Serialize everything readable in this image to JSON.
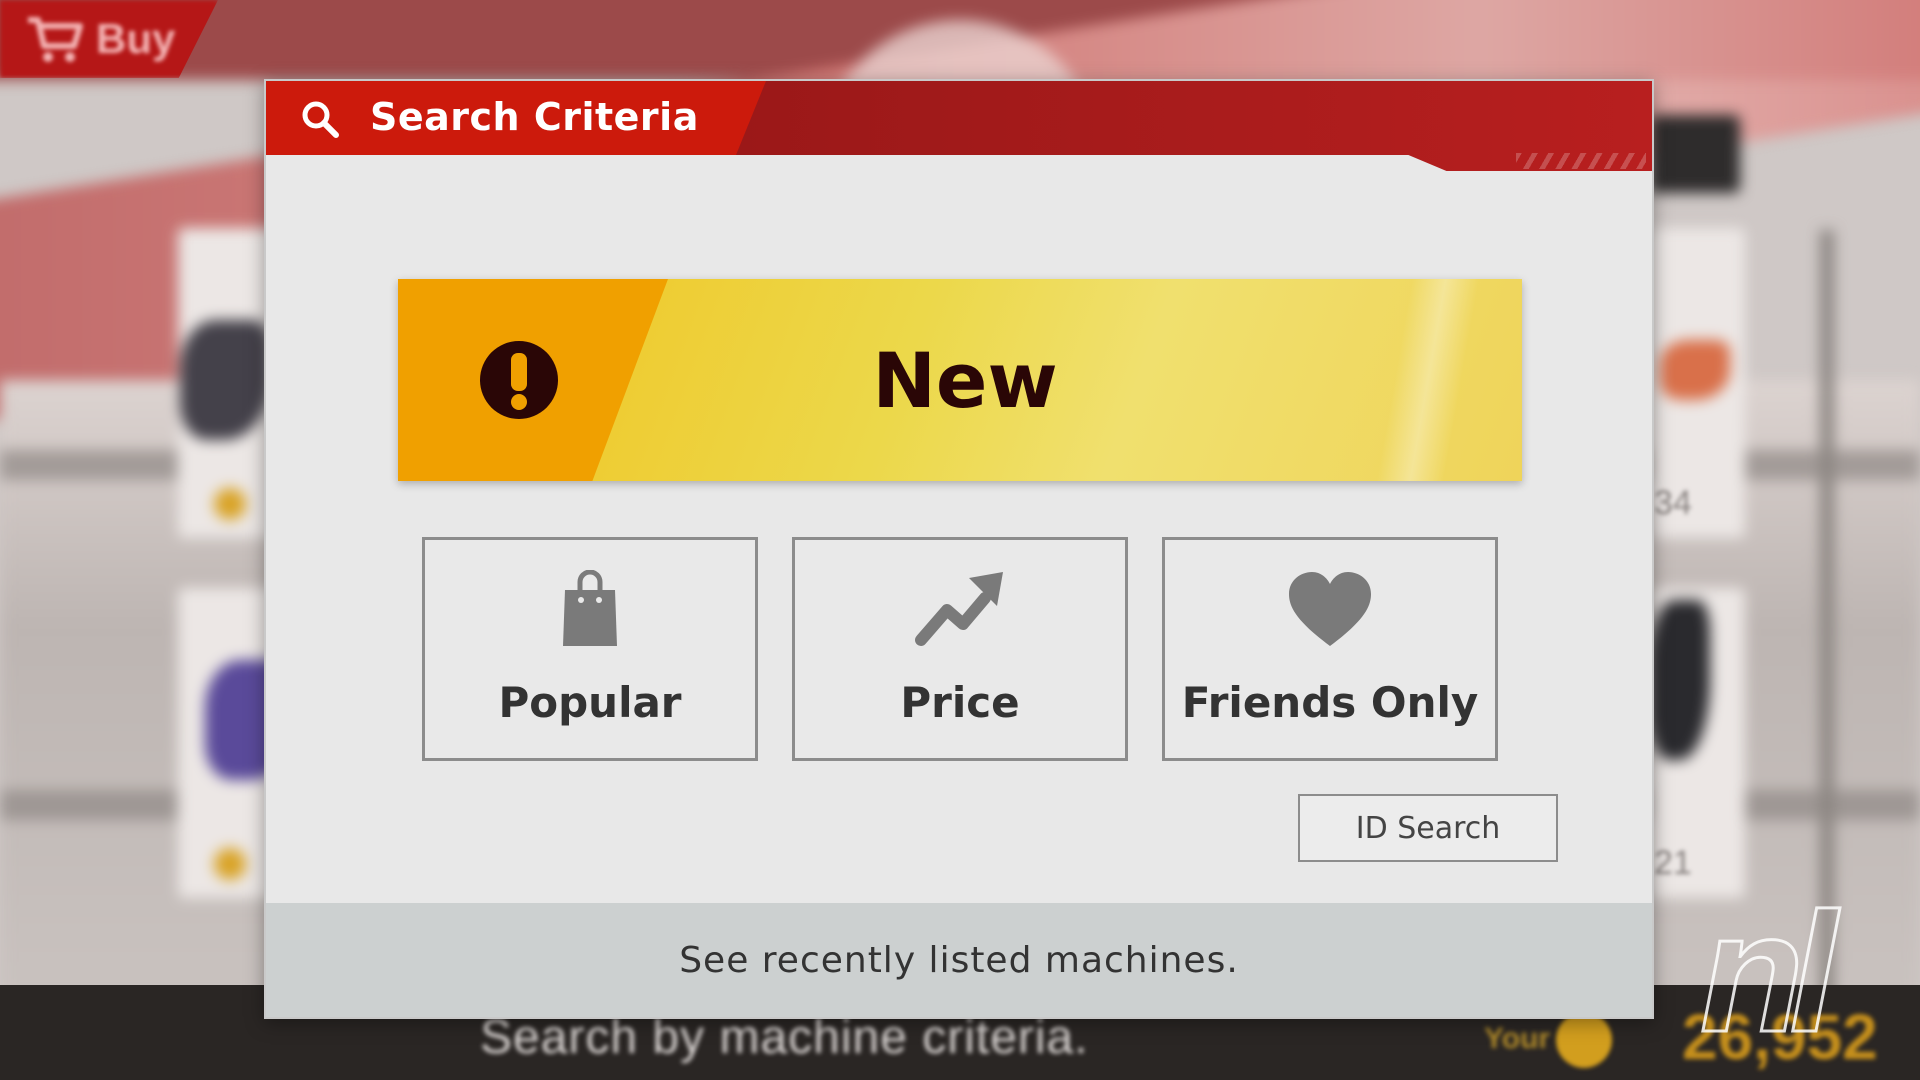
{
  "background": {
    "buy_tab_label": "Buy",
    "bottom_hint": "Search by machine criteria.",
    "wallet_label": "Your",
    "wallet_amount": "26,952",
    "card_number_1": "34",
    "card_number_2": "21",
    "watermark": "nl"
  },
  "dialog": {
    "title": "Search Criteria",
    "new_label": "New",
    "options": [
      {
        "label": "Popular",
        "icon": "shopping-bag-icon"
      },
      {
        "label": "Price",
        "icon": "trend-up-icon"
      },
      {
        "label": "Friends Only",
        "icon": "heart-icon"
      }
    ],
    "id_search_label": "ID Search",
    "footer_text": "See recently listed machines."
  },
  "colors": {
    "header_red": "#cc1a0c",
    "header_dark_red": "#8e1414",
    "new_yellow": "#ecd84a",
    "new_orange": "#f0a000",
    "icon_gray": "#7a7a7a"
  }
}
